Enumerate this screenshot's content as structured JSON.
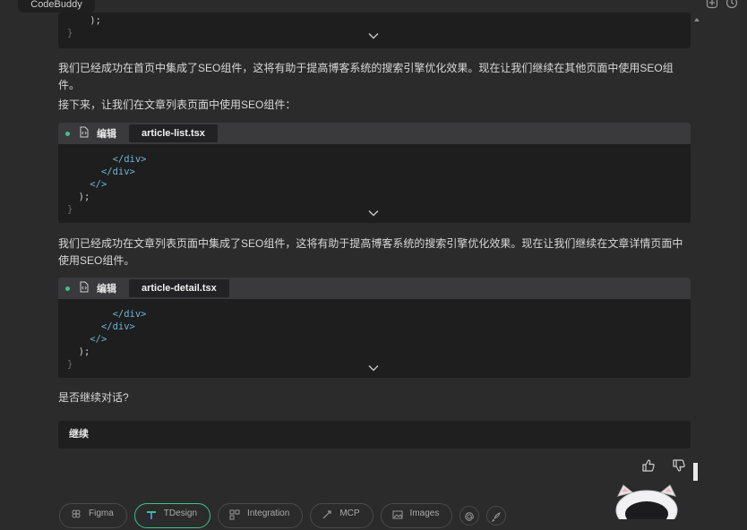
{
  "window": {
    "title": "CodeBuddy"
  },
  "blocks": [
    {
      "edit_label": "",
      "file": "",
      "lines": [
        {
          "text": "    );",
          "dim": false
        },
        {
          "text": "}",
          "dim": true
        }
      ]
    },
    {
      "edit_label": "编辑",
      "file": "article-list.tsx",
      "lines": [
        {
          "indent": "        ",
          "tag": "</div>",
          "dim": false
        },
        {
          "indent": "      ",
          "tag": "</div>",
          "dim": false
        },
        {
          "indent": "    ",
          "tag": "</>",
          "dim": false
        },
        {
          "text": "  );",
          "dim": false
        },
        {
          "text": "}",
          "dim": true
        }
      ]
    },
    {
      "edit_label": "编辑",
      "file": "article-detail.tsx",
      "lines": [
        {
          "indent": "        ",
          "tag": "</div>",
          "dim": false
        },
        {
          "indent": "      ",
          "tag": "</div>",
          "dim": false
        },
        {
          "indent": "    ",
          "tag": "</>",
          "dim": false
        },
        {
          "text": "  );",
          "dim": false
        },
        {
          "text": "}",
          "dim": true
        }
      ]
    }
  ],
  "messages": {
    "m1": "我们已经成功在首页中集成了SEO组件，这将有助于提高博客系统的搜索引擎优化效果。现在让我们继续在其他页面中使用SEO组件。",
    "m2": "接下来，让我们在文章列表页面中使用SEO组件：",
    "m3": "我们已经成功在文章列表页面中集成了SEO组件，这将有助于提高博客系统的搜索引擎优化效果。现在让我们继续在文章详情页面中使用SEO组件。",
    "m4": "是否继续对话?"
  },
  "continue_label": "继续",
  "chips": [
    {
      "label": "Figma",
      "icon": "figma-icon"
    },
    {
      "label": "TDesign",
      "icon": "tdesign-icon",
      "active": true
    },
    {
      "label": "Integration",
      "icon": "integration-icon"
    },
    {
      "label": "MCP",
      "icon": "mcp-icon"
    },
    {
      "label": "Images",
      "icon": "image-icon"
    }
  ],
  "colors": {
    "accent": "#3cc28b",
    "tag": "#6fb3d2",
    "background": "#2b2b2c"
  }
}
